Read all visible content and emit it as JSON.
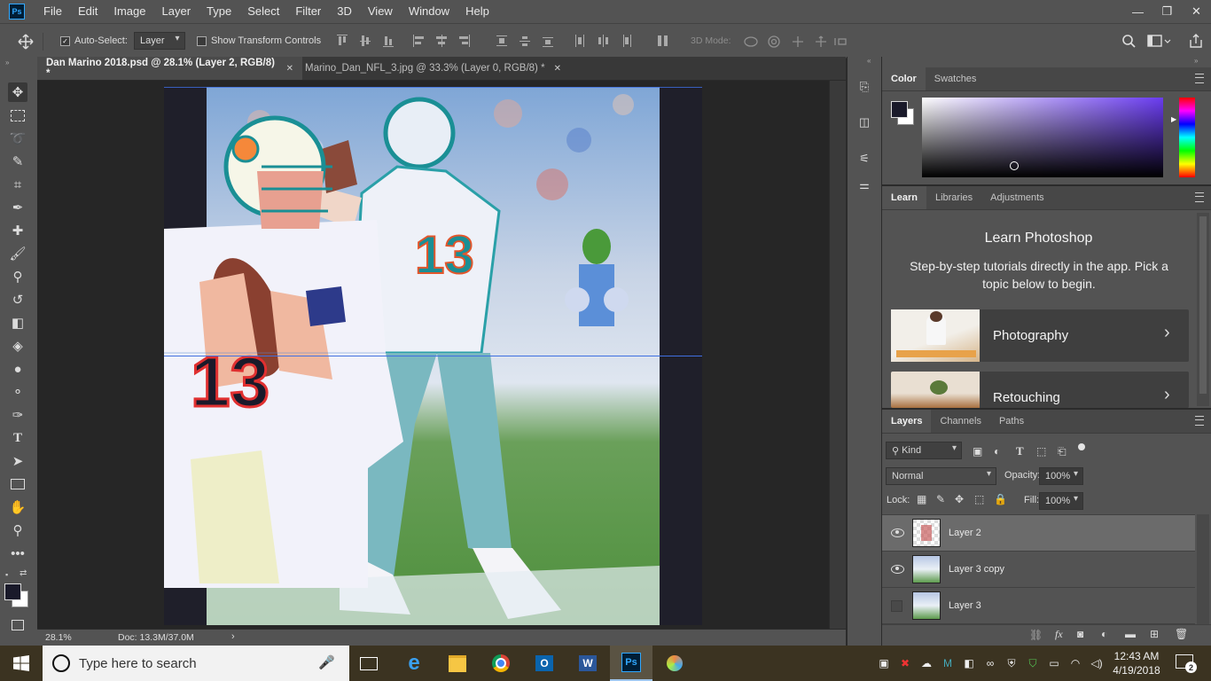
{
  "app": {
    "menu": [
      "File",
      "Edit",
      "Image",
      "Layer",
      "Type",
      "Select",
      "Filter",
      "3D",
      "View",
      "Window",
      "Help"
    ],
    "window_controls": [
      "—",
      "❐",
      "✕"
    ]
  },
  "options_bar": {
    "auto_select_label": "Auto-Select:",
    "auto_select_checked": true,
    "auto_select_value": "Layer",
    "show_transform_label": "Show Transform Controls",
    "show_transform_checked": false,
    "mode_3d_label": "3D Mode:"
  },
  "tabs": [
    {
      "label": "Dan Marino 2018.psd @ 28.1% (Layer 2, RGB/8) *",
      "active": true
    },
    {
      "label": "Marino_Dan_NFL_3.jpg @ 33.3% (Layer 0, RGB/8) *",
      "active": false
    }
  ],
  "status": {
    "zoom": "28.1%",
    "doc": "Doc: 13.3M/37.0M"
  },
  "color_panel": {
    "tabs": [
      "Color",
      "Swatches"
    ],
    "foreground": "#1a1a2a",
    "background": "#ffffff",
    "hue": "#6a3cf0"
  },
  "learn_panel": {
    "tabs": [
      "Learn",
      "Libraries",
      "Adjustments"
    ],
    "title": "Learn Photoshop",
    "description": "Step-by-step tutorials directly in the app. Pick a topic below to begin.",
    "topics": [
      "Photography",
      "Retouching"
    ]
  },
  "layers_panel": {
    "tabs": [
      "Layers",
      "Channels",
      "Paths"
    ],
    "filter": "Kind",
    "blend_mode": "Normal",
    "opacity_label": "Opacity:",
    "opacity": "100%",
    "lock_label": "Lock:",
    "fill_label": "Fill:",
    "fill": "100%",
    "layers": [
      {
        "name": "Layer 2",
        "visible": true,
        "selected": true
      },
      {
        "name": "Layer 3 copy",
        "visible": true,
        "selected": false
      },
      {
        "name": "Layer 3",
        "visible": false,
        "selected": false
      }
    ]
  },
  "taskbar": {
    "search_placeholder": "Type here to search",
    "time": "12:43 AM",
    "date": "4/19/2018",
    "notifications": "2"
  }
}
